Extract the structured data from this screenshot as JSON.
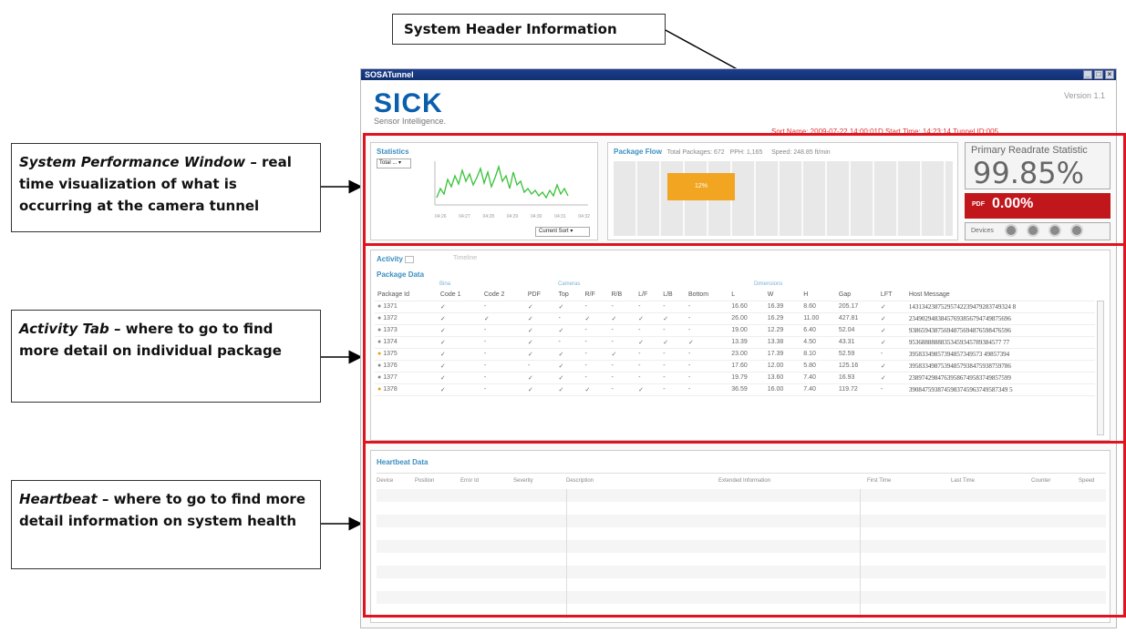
{
  "callouts": {
    "header": "System Header Information",
    "perf_title": "System Performance Window",
    "perf_body": " – real time visualization of what is occurring at the camera tunnel",
    "activity_title": "Activity Tab",
    "activity_body": " – where to go to find more detail on individual package",
    "heartbeat_title": "Heartbeat",
    "heartbeat_body": " – where to go to find more detail information on system health"
  },
  "app": {
    "window_title": "SOSATunnel",
    "logo": "SICK",
    "logo_sub": "Sensor Intelligence.",
    "version": "Version 1.1",
    "sort_line": "Sort Name: 2009-07-22 14:00:01D    Start Time: 14:23:14    Tunnel ID:005"
  },
  "stats": {
    "title": "Statistics",
    "select": "Total ...",
    "sort_select": "Current Sort",
    "x_ticks": [
      "04:26",
      "04:27",
      "04:28",
      "04:29",
      "04:30",
      "04:31",
      "04:32"
    ]
  },
  "flow": {
    "title": "Package Flow",
    "total": "Total Packages: 672",
    "pph": "PPH: 1,165",
    "speed": "Speed: 248.85 ft/min",
    "bar_label": "12%"
  },
  "readrate": {
    "title": "Primary Readrate Statistic",
    "value": "99.85%",
    "pdf_label": "PDF",
    "pdf_value": "0.00%",
    "devices_label": "Devices"
  },
  "activity": {
    "tab_active": "Activity",
    "tab_inactive": "Timeline",
    "section": "Package Data",
    "group_headers": [
      "Bina",
      "Cameras",
      "Dimensions"
    ],
    "columns": [
      "Package Id",
      "Code 1",
      "Code 2",
      "PDF",
      "Top",
      "R/F",
      "R/B",
      "L/F",
      "L/B",
      "Bottom",
      "L",
      "W",
      "H",
      "Gap",
      "LFT",
      "Host Message"
    ],
    "rows": [
      [
        "1371",
        "✓",
        "-",
        "✓",
        "✓",
        "-",
        "-",
        "-",
        "-",
        "-",
        "16.60",
        "16.39",
        "8.60",
        "205.17",
        "✓",
        "14313423875295742239479283749324 8"
      ],
      [
        "1372",
        "✓",
        "✓",
        "✓",
        "-",
        "✓",
        "✓",
        "✓",
        "✓",
        "-",
        "26.00",
        "16.29",
        "11.00",
        "427.81",
        "✓",
        "23490294838457693856794749875696"
      ],
      [
        "1373",
        "✓",
        "-",
        "✓",
        "✓",
        "-",
        "-",
        "-",
        "-",
        "-",
        "19.00",
        "12.29",
        "6.40",
        "52.04",
        "✓",
        "93865943875694875694876598476596"
      ],
      [
        "1374",
        "✓",
        "-",
        "✓",
        "-",
        "-",
        "-",
        "✓",
        "✓",
        "✓",
        "13.39",
        "13.38",
        "4.50",
        "43.31",
        "✓",
        "95368888888353459345789384577 77"
      ],
      [
        "1375",
        "✓",
        "-",
        "✓",
        "✓",
        "-",
        "✓",
        "-",
        "-",
        "-",
        "23.00",
        "17.39",
        "8.10",
        "52.59",
        "-",
        "39583349857394857349573 49857394"
      ],
      [
        "1376",
        "✓",
        "-",
        "-",
        "✓",
        "-",
        "-",
        "-",
        "-",
        "-",
        "17.60",
        "12.00",
        "5.80",
        "125.16",
        "✓",
        "39583349875394857938475938759786"
      ],
      [
        "1377",
        "✓",
        "-",
        "✓",
        "✓",
        "-",
        "-",
        "-",
        "-",
        "-",
        "19.79",
        "13.60",
        "7.40",
        "16.93",
        "✓",
        "23897429847639586749583749857599"
      ],
      [
        "1378",
        "✓",
        "-",
        "✓",
        "✓",
        "✓",
        "-",
        "✓",
        "-",
        "-",
        "36.59",
        "16.00",
        "7.40",
        "119.72",
        "-",
        "3908475938745983745963749587349 5"
      ]
    ]
  },
  "heartbeat": {
    "section": "Heartbeat Data",
    "columns": [
      "Device",
      "Position",
      "Error Id",
      "Severity",
      "Description",
      "Extended Information",
      "First Time",
      "Last Time",
      "Counter",
      "Speed"
    ]
  }
}
